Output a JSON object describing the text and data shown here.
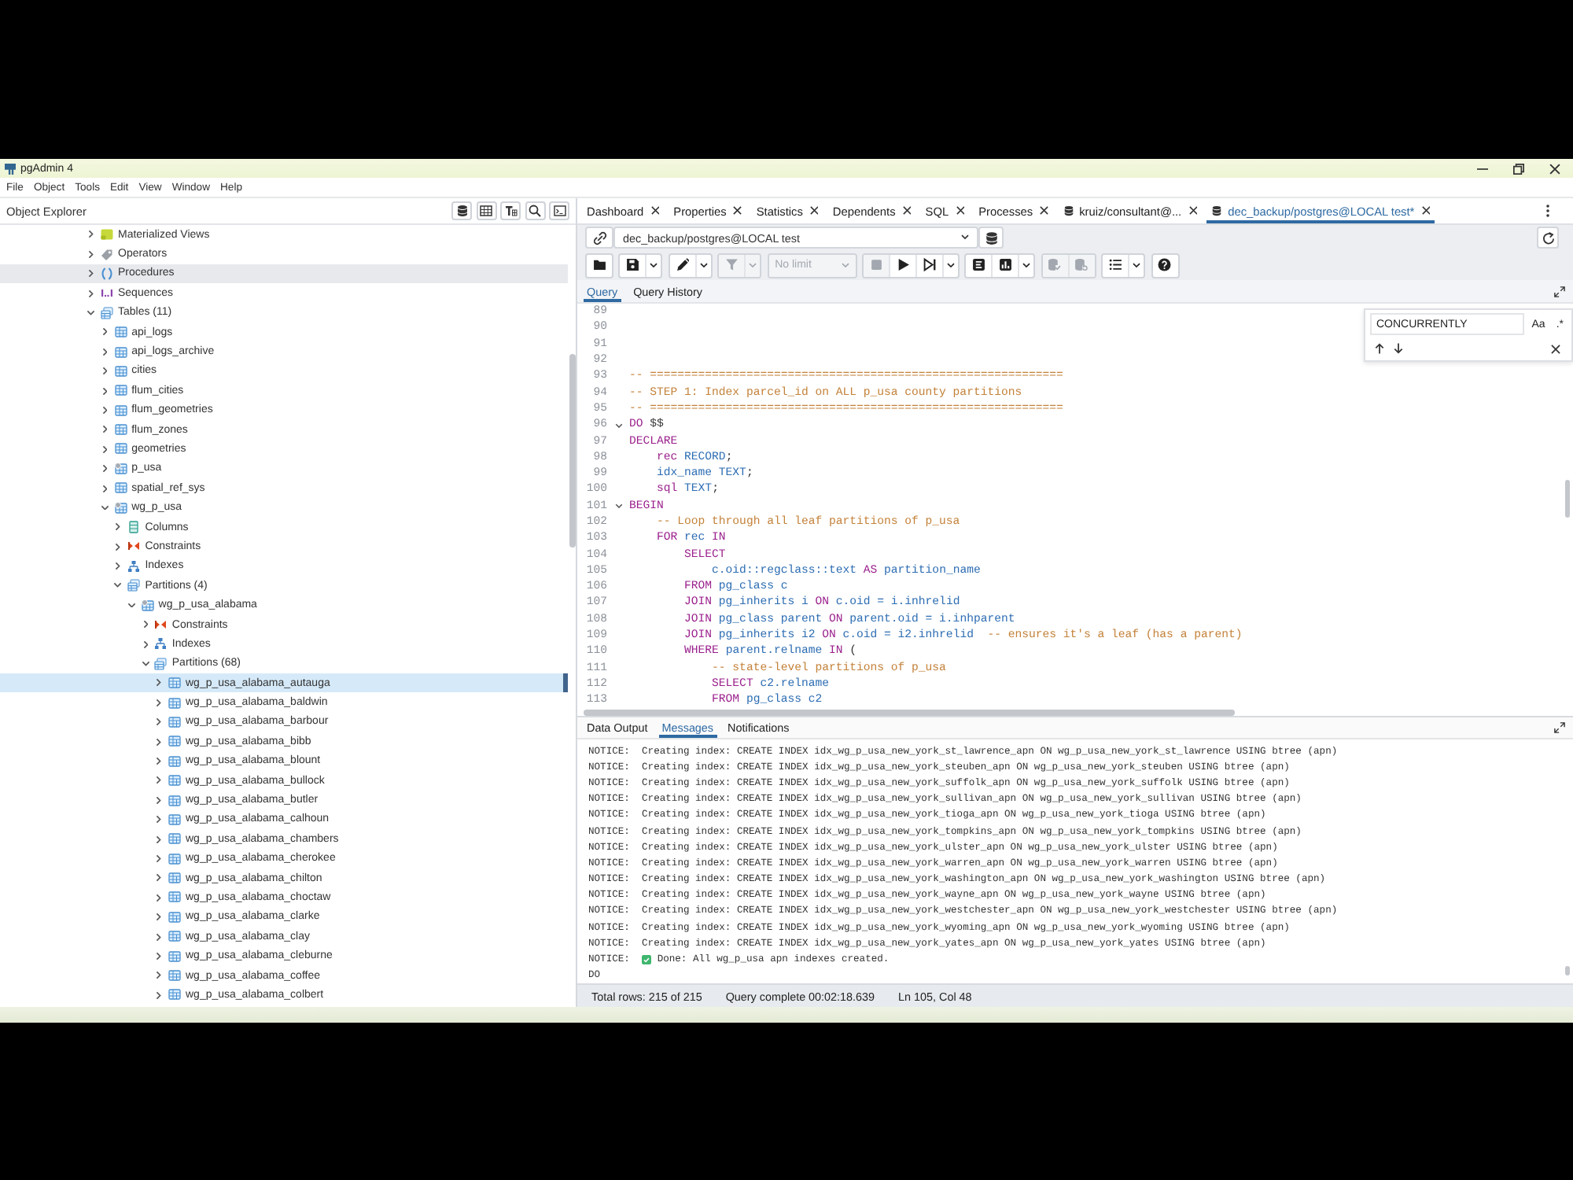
{
  "window": {
    "title": "pgAdmin 4"
  },
  "menu": [
    "File",
    "Object",
    "Tools",
    "Edit",
    "View",
    "Window",
    "Help"
  ],
  "object_explorer": {
    "title": "Object Explorer",
    "tree": [
      {
        "label": "Materialized Views",
        "kind": "materialized_view",
        "expanded": false,
        "selected": false,
        "hovered": false
      },
      {
        "label": "Operators",
        "kind": "operator",
        "expanded": false,
        "selected": false,
        "hovered": false
      },
      {
        "label": "Procedures",
        "kind": "procedure",
        "expanded": false,
        "selected": false,
        "hovered": true
      },
      {
        "label": "Sequences",
        "kind": "sequence",
        "expanded": false,
        "selected": false,
        "hovered": false
      },
      {
        "label": "Tables (11)",
        "kind": "tables",
        "expanded": true,
        "selected": false,
        "hovered": false,
        "children": [
          {
            "label": "api_logs",
            "kind": "table",
            "expanded": false,
            "selected": false,
            "hovered": false
          },
          {
            "label": "api_logs_archive",
            "kind": "table",
            "expanded": false,
            "selected": false,
            "hovered": false
          },
          {
            "label": "cities",
            "kind": "table",
            "expanded": false,
            "selected": false,
            "hovered": false
          },
          {
            "label": "flum_cities",
            "kind": "table",
            "expanded": false,
            "selected": false,
            "hovered": false
          },
          {
            "label": "flum_geometries",
            "kind": "table",
            "expanded": false,
            "selected": false,
            "hovered": false
          },
          {
            "label": "flum_zones",
            "kind": "table",
            "expanded": false,
            "selected": false,
            "hovered": false
          },
          {
            "label": "geometries",
            "kind": "table",
            "expanded": false,
            "selected": false,
            "hovered": false
          },
          {
            "label": "p_usa",
            "kind": "partitioned_table",
            "expanded": false,
            "selected": false,
            "hovered": false
          },
          {
            "label": "spatial_ref_sys",
            "kind": "table",
            "expanded": false,
            "selected": false,
            "hovered": false
          },
          {
            "label": "wg_p_usa",
            "kind": "partitioned_table",
            "expanded": true,
            "selected": false,
            "hovered": false,
            "children": [
              {
                "label": "Columns",
                "kind": "columns",
                "expanded": false,
                "selected": false,
                "hovered": false
              },
              {
                "label": "Constraints",
                "kind": "constraints",
                "expanded": false,
                "selected": false,
                "hovered": false
              },
              {
                "label": "Indexes",
                "kind": "indexes",
                "expanded": false,
                "selected": false,
                "hovered": false
              },
              {
                "label": "Partitions (4)",
                "kind": "partitions",
                "expanded": true,
                "selected": false,
                "hovered": false,
                "children": [
                  {
                    "label": "wg_p_usa_alabama",
                    "kind": "partitioned_table",
                    "expanded": true,
                    "selected": false,
                    "hovered": false,
                    "children": [
                      {
                        "label": "Constraints",
                        "kind": "constraints",
                        "expanded": false,
                        "selected": false,
                        "hovered": false
                      },
                      {
                        "label": "Indexes",
                        "kind": "indexes",
                        "expanded": false,
                        "selected": false,
                        "hovered": false
                      },
                      {
                        "label": "Partitions (68)",
                        "kind": "partitions",
                        "expanded": true,
                        "selected": false,
                        "hovered": false,
                        "children": [
                          {
                            "label": "wg_p_usa_alabama_autauga",
                            "kind": "table",
                            "expanded": false,
                            "selected": true,
                            "hovered": false
                          },
                          {
                            "label": "wg_p_usa_alabama_baldwin",
                            "kind": "table",
                            "expanded": false,
                            "selected": false,
                            "hovered": false
                          },
                          {
                            "label": "wg_p_usa_alabama_barbour",
                            "kind": "table",
                            "expanded": false,
                            "selected": false,
                            "hovered": false
                          },
                          {
                            "label": "wg_p_usa_alabama_bibb",
                            "kind": "table",
                            "expanded": false,
                            "selected": false,
                            "hovered": false
                          },
                          {
                            "label": "wg_p_usa_alabama_blount",
                            "kind": "table",
                            "expanded": false,
                            "selected": false,
                            "hovered": false
                          },
                          {
                            "label": "wg_p_usa_alabama_bullock",
                            "kind": "table",
                            "expanded": false,
                            "selected": false,
                            "hovered": false
                          },
                          {
                            "label": "wg_p_usa_alabama_butler",
                            "kind": "table",
                            "expanded": false,
                            "selected": false,
                            "hovered": false
                          },
                          {
                            "label": "wg_p_usa_alabama_calhoun",
                            "kind": "table",
                            "expanded": false,
                            "selected": false,
                            "hovered": false
                          },
                          {
                            "label": "wg_p_usa_alabama_chambers",
                            "kind": "table",
                            "expanded": false,
                            "selected": false,
                            "hovered": false
                          },
                          {
                            "label": "wg_p_usa_alabama_cherokee",
                            "kind": "table",
                            "expanded": false,
                            "selected": false,
                            "hovered": false
                          },
                          {
                            "label": "wg_p_usa_alabama_chilton",
                            "kind": "table",
                            "expanded": false,
                            "selected": false,
                            "hovered": false
                          },
                          {
                            "label": "wg_p_usa_alabama_choctaw",
                            "kind": "table",
                            "expanded": false,
                            "selected": false,
                            "hovered": false
                          },
                          {
                            "label": "wg_p_usa_alabama_clarke",
                            "kind": "table",
                            "expanded": false,
                            "selected": false,
                            "hovered": false
                          },
                          {
                            "label": "wg_p_usa_alabama_clay",
                            "kind": "table",
                            "expanded": false,
                            "selected": false,
                            "hovered": false
                          },
                          {
                            "label": "wg_p_usa_alabama_cleburne",
                            "kind": "table",
                            "expanded": false,
                            "selected": false,
                            "hovered": false
                          },
                          {
                            "label": "wg_p_usa_alabama_coffee",
                            "kind": "table",
                            "expanded": false,
                            "selected": false,
                            "hovered": false
                          },
                          {
                            "label": "wg_p_usa_alabama_colbert",
                            "kind": "table",
                            "expanded": false,
                            "selected": false,
                            "hovered": false
                          }
                        ]
                      }
                    ]
                  }
                ]
              }
            ]
          }
        ]
      }
    ]
  },
  "tabs": [
    {
      "label": "Dashboard",
      "kind": "panel",
      "selected": false
    },
    {
      "label": "Properties",
      "kind": "panel",
      "selected": false
    },
    {
      "label": "Statistics",
      "kind": "panel",
      "selected": false
    },
    {
      "label": "Dependents",
      "kind": "panel",
      "selected": false
    },
    {
      "label": "SQL",
      "kind": "panel",
      "selected": false
    },
    {
      "label": "Processes",
      "kind": "panel",
      "selected": false
    },
    {
      "label": "kruiz/consultant@...",
      "kind": "query_tool",
      "selected": false
    },
    {
      "label": "dec_backup/postgres@LOCAL test*",
      "kind": "query_tool",
      "selected": true
    }
  ],
  "connection": {
    "value": "dec_backup/postgres@LOCAL test"
  },
  "toolbar": [
    {
      "items": [
        {
          "kind": "open_file",
          "disabled": false
        }
      ]
    },
    {
      "items": [
        {
          "kind": "save",
          "disabled": false
        },
        {
          "kind": "caret",
          "disabled": false
        }
      ]
    },
    {
      "items": [
        {
          "kind": "edit",
          "disabled": false
        },
        {
          "kind": "caret",
          "disabled": false
        }
      ]
    },
    {
      "items": [
        {
          "kind": "filter",
          "disabled": true
        },
        {
          "kind": "caret",
          "disabled": true
        }
      ]
    },
    {
      "items": [
        {
          "kind": "limit",
          "label": "No limit",
          "disabled": true
        }
      ]
    },
    {
      "items": [
        {
          "kind": "stop",
          "disabled": true
        },
        {
          "kind": "execute",
          "disabled": false
        },
        {
          "kind": "execute_script",
          "disabled": false
        },
        {
          "kind": "caret",
          "disabled": false
        }
      ]
    },
    {
      "items": [
        {
          "kind": "explain",
          "disabled": false
        },
        {
          "kind": "explain_analyze",
          "disabled": false
        },
        {
          "kind": "caret",
          "disabled": false
        }
      ]
    },
    {
      "items": [
        {
          "kind": "commit",
          "disabled": true
        },
        {
          "kind": "rollback",
          "disabled": true
        }
      ]
    },
    {
      "items": [
        {
          "kind": "macros",
          "disabled": false
        },
        {
          "kind": "caret",
          "disabled": false
        }
      ]
    },
    {
      "items": [
        {
          "kind": "help",
          "disabled": false
        }
      ]
    }
  ],
  "editor_tabs": [
    {
      "label": "Query",
      "selected": true
    },
    {
      "label": "Query History",
      "selected": false
    }
  ],
  "editor": {
    "lines": [
      {
        "number": "89",
        "fold": false
      },
      {
        "number": "90",
        "fold": false
      },
      {
        "number": "91",
        "fold": false
      },
      {
        "number": "92",
        "fold": false
      },
      {
        "number": "93",
        "fold": false,
        "tokens": [
          {
            "text": "-- ============================================================",
            "kind": "comment"
          }
        ]
      },
      {
        "number": "94",
        "fold": false,
        "tokens": [
          {
            "text": "-- STEP 1: Index parcel_id on ALL p_usa county partitions",
            "kind": "comment"
          }
        ]
      },
      {
        "number": "95",
        "fold": false,
        "tokens": [
          {
            "text": "-- ============================================================",
            "kind": "comment"
          }
        ]
      },
      {
        "number": "96",
        "fold": true,
        "tokens": [
          {
            "text": "DO",
            "kind": "keyword"
          },
          {
            "text": " $$",
            "kind": "plain"
          }
        ]
      },
      {
        "number": "97",
        "fold": false,
        "tokens": [
          {
            "text": "DECLARE",
            "kind": "keyword"
          }
        ]
      },
      {
        "number": "98",
        "fold": false,
        "tokens": [
          {
            "text": "    rec",
            "kind": "keyword"
          },
          {
            "text": " RECORD",
            "kind": "name"
          },
          {
            "text": ";",
            "kind": "plain"
          }
        ]
      },
      {
        "number": "99",
        "fold": false,
        "tokens": [
          {
            "text": "    idx_name TEXT",
            "kind": "name"
          },
          {
            "text": ";",
            "kind": "plain"
          }
        ]
      },
      {
        "number": "100",
        "fold": false,
        "tokens": [
          {
            "text": "    sql",
            "kind": "keyword"
          },
          {
            "text": " TEXT",
            "kind": "name"
          },
          {
            "text": ";",
            "kind": "plain"
          }
        ]
      },
      {
        "number": "101",
        "fold": true,
        "tokens": [
          {
            "text": "BEGIN",
            "kind": "keyword"
          }
        ]
      },
      {
        "number": "102",
        "fold": false,
        "tokens": [
          {
            "text": "    -- Loop through all leaf partitions of p_usa",
            "kind": "comment"
          }
        ]
      },
      {
        "number": "103",
        "fold": false,
        "tokens": [
          {
            "text": "    FOR",
            "kind": "keyword"
          },
          {
            "text": " rec",
            "kind": "name"
          },
          {
            "text": " IN",
            "kind": "keyword"
          }
        ]
      },
      {
        "number": "104",
        "fold": false,
        "tokens": [
          {
            "text": "        SELECT",
            "kind": "keyword"
          }
        ]
      },
      {
        "number": "105",
        "fold": false,
        "tokens": [
          {
            "text": "            c.oid::regclass::text",
            "kind": "name"
          },
          {
            "text": " AS",
            "kind": "keyword"
          },
          {
            "text": " partition_name",
            "kind": "name"
          }
        ]
      },
      {
        "number": "106",
        "fold": false,
        "tokens": [
          {
            "text": "        FROM",
            "kind": "keyword"
          },
          {
            "text": " pg_class c",
            "kind": "name"
          }
        ]
      },
      {
        "number": "107",
        "fold": false,
        "tokens": [
          {
            "text": "        JOIN",
            "kind": "keyword"
          },
          {
            "text": " pg_inherits i",
            "kind": "name"
          },
          {
            "text": " ON",
            "kind": "keyword"
          },
          {
            "text": " c.oid = i.inhrelid",
            "kind": "name"
          }
        ]
      },
      {
        "number": "108",
        "fold": false,
        "tokens": [
          {
            "text": "        JOIN",
            "kind": "keyword"
          },
          {
            "text": " pg_class parent",
            "kind": "name"
          },
          {
            "text": " ON",
            "kind": "keyword"
          },
          {
            "text": " parent.oid = i.inhparent",
            "kind": "name"
          }
        ]
      },
      {
        "number": "109",
        "fold": false,
        "tokens": [
          {
            "text": "        JOIN",
            "kind": "keyword"
          },
          {
            "text": " pg_inherits i2",
            "kind": "name"
          },
          {
            "text": " ON",
            "kind": "keyword"
          },
          {
            "text": " c.oid = i2.inhrelid",
            "kind": "name"
          },
          {
            "text": "  -- ensures it's a leaf (has a parent)",
            "kind": "comment"
          }
        ]
      },
      {
        "number": "110",
        "fold": false,
        "tokens": [
          {
            "text": "        WHERE",
            "kind": "keyword"
          },
          {
            "text": " parent.relname",
            "kind": "name"
          },
          {
            "text": " IN",
            "kind": "keyword"
          },
          {
            "text": " (",
            "kind": "plain"
          }
        ]
      },
      {
        "number": "111",
        "fold": false,
        "tokens": [
          {
            "text": "            -- state-level partitions of p_usa",
            "kind": "comment"
          }
        ]
      },
      {
        "number": "112",
        "fold": false,
        "tokens": [
          {
            "text": "            SELECT",
            "kind": "keyword"
          },
          {
            "text": " c2.relname",
            "kind": "name"
          }
        ]
      },
      {
        "number": "113",
        "fold": false,
        "tokens": [
          {
            "text": "            FROM",
            "kind": "keyword"
          },
          {
            "text": " pg_class c2",
            "kind": "name"
          }
        ]
      }
    ]
  },
  "find": {
    "value": "CONCURRENTLY",
    "case_toggle": "Aa",
    "regex_toggle": ".*"
  },
  "result_tabs": [
    {
      "label": "Data Output",
      "selected": false
    },
    {
      "label": "Messages",
      "selected": true
    },
    {
      "label": "Notifications",
      "selected": false
    }
  ],
  "messages": [
    {
      "kind": "text",
      "level": "NOTICE:",
      "text": "Creating index: CREATE INDEX idx_wg_p_usa_new_york_st_lawrence_apn ON wg_p_usa_new_york_st_lawrence USING btree (apn)"
    },
    {
      "kind": "text",
      "level": "NOTICE:",
      "text": "Creating index: CREATE INDEX idx_wg_p_usa_new_york_steuben_apn ON wg_p_usa_new_york_steuben USING btree (apn)"
    },
    {
      "kind": "text",
      "level": "NOTICE:",
      "text": "Creating index: CREATE INDEX idx_wg_p_usa_new_york_suffolk_apn ON wg_p_usa_new_york_suffolk USING btree (apn)"
    },
    {
      "kind": "text",
      "level": "NOTICE:",
      "text": "Creating index: CREATE INDEX idx_wg_p_usa_new_york_sullivan_apn ON wg_p_usa_new_york_sullivan USING btree (apn)"
    },
    {
      "kind": "text",
      "level": "NOTICE:",
      "text": "Creating index: CREATE INDEX idx_wg_p_usa_new_york_tioga_apn ON wg_p_usa_new_york_tioga USING btree (apn)"
    },
    {
      "kind": "text",
      "level": "NOTICE:",
      "text": "Creating index: CREATE INDEX idx_wg_p_usa_new_york_tompkins_apn ON wg_p_usa_new_york_tompkins USING btree (apn)"
    },
    {
      "kind": "text",
      "level": "NOTICE:",
      "text": "Creating index: CREATE INDEX idx_wg_p_usa_new_york_ulster_apn ON wg_p_usa_new_york_ulster USING btree (apn)"
    },
    {
      "kind": "text",
      "level": "NOTICE:",
      "text": "Creating index: CREATE INDEX idx_wg_p_usa_new_york_warren_apn ON wg_p_usa_new_york_warren USING btree (apn)"
    },
    {
      "kind": "text",
      "level": "NOTICE:",
      "text": "Creating index: CREATE INDEX idx_wg_p_usa_new_york_washington_apn ON wg_p_usa_new_york_washington USING btree (apn)"
    },
    {
      "kind": "text",
      "level": "NOTICE:",
      "text": "Creating index: CREATE INDEX idx_wg_p_usa_new_york_wayne_apn ON wg_p_usa_new_york_wayne USING btree (apn)"
    },
    {
      "kind": "text",
      "level": "NOTICE:",
      "text": "Creating index: CREATE INDEX idx_wg_p_usa_new_york_westchester_apn ON wg_p_usa_new_york_westchester USING btree (apn)"
    },
    {
      "kind": "text",
      "level": "NOTICE:",
      "text": "Creating index: CREATE INDEX idx_wg_p_usa_new_york_wyoming_apn ON wg_p_usa_new_york_wyoming USING btree (apn)"
    },
    {
      "kind": "text",
      "level": "NOTICE:",
      "text": "Creating index: CREATE INDEX idx_wg_p_usa_new_york_yates_apn ON wg_p_usa_new_york_yates USING btree (apn)"
    },
    {
      "kind": "success",
      "level": "NOTICE:",
      "text": "Done: All wg_p_usa apn indexes created."
    },
    {
      "kind": "plain",
      "text": "DO"
    }
  ],
  "status_bar": {
    "rows": "Total rows: 215 of 215",
    "query": "Query complete 00:02:18.639",
    "cursor": "Ln 105, Col 48"
  }
}
